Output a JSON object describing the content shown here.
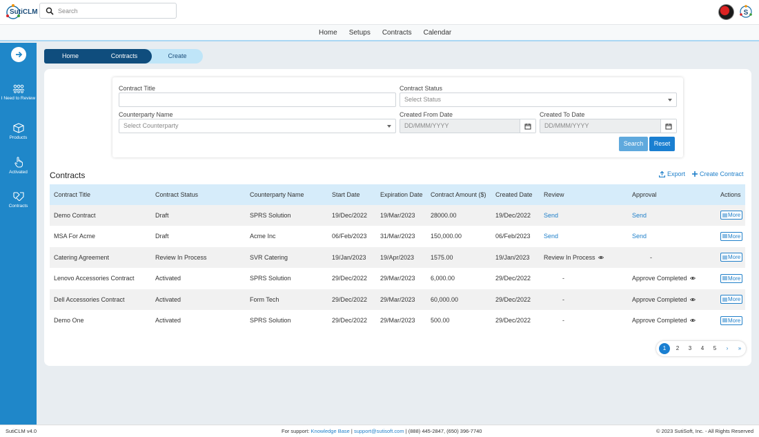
{
  "app": {
    "logo_text": "SutiCLM"
  },
  "search": {
    "placeholder": "Search"
  },
  "nav": {
    "items": [
      "Home",
      "Setups",
      "Contracts",
      "Calendar"
    ]
  },
  "sidebar": {
    "items": [
      {
        "label": "I Need to Review",
        "icon": "people-review-icon"
      },
      {
        "label": "Products",
        "icon": "box-icon"
      },
      {
        "label": "Activated",
        "icon": "hand-pointer-icon"
      },
      {
        "label": "Contracts",
        "icon": "handshake-icon"
      }
    ]
  },
  "breadcrumb": {
    "home": "Home",
    "contracts": "Contracts",
    "create": "Create"
  },
  "filters": {
    "contract_title_label": "Contract Title",
    "contract_title_value": "",
    "contract_status_label": "Contract Status",
    "contract_status_placeholder": "Select Status",
    "counterparty_label": "Counterparty Name",
    "counterparty_placeholder": "Select Counterparty",
    "created_from_label": "Created From Date",
    "created_from_placeholder": "DD/MMM/YYYY",
    "created_to_label": "Created To Date",
    "created_to_placeholder": "DD/MMM/YYYY",
    "search_button": "Search",
    "reset_button": "Reset"
  },
  "contracts": {
    "title": "Contracts",
    "export_label": "Export",
    "create_label": "Create Contract",
    "columns": [
      "Contract Title",
      "Contract Status",
      "Counterparty Name",
      "Start Date",
      "Expiration Date",
      "Contract Amount ($)",
      "Created Date",
      "Review",
      "Approval",
      "Actions"
    ],
    "rows": [
      {
        "title": "Demo Contract",
        "status": "Draft",
        "counterparty": "SPRS Solution",
        "start": "19/Dec/2022",
        "expiration": "19/Mar/2023",
        "amount": "28000.00",
        "created": "19/Dec/2022",
        "review": "Send",
        "review_type": "link",
        "approval": "Send",
        "approval_type": "link",
        "action": "More"
      },
      {
        "title": "MSA For Acme",
        "status": "Draft",
        "counterparty": "Acme Inc",
        "start": "06/Feb/2023",
        "expiration": "31/Mar/2023",
        "amount": "150,000.00",
        "created": "06/Feb/2023",
        "review": "Send",
        "review_type": "link",
        "approval": "Send",
        "approval_type": "link",
        "action": "More"
      },
      {
        "title": "Catering Agreement",
        "status": "Review In Process",
        "counterparty": "SVR Catering",
        "start": "19/Jan/2023",
        "expiration": "19/Apr/2023",
        "amount": "1575.00",
        "created": "19/Jan/2023",
        "review": "Review In Process",
        "review_type": "eye",
        "approval": "-",
        "approval_type": "dash",
        "action": "More"
      },
      {
        "title": "Lenovo Accessories Contract",
        "status": "Activated",
        "counterparty": "SPRS Solution",
        "start": "29/Dec/2022",
        "expiration": "29/Mar/2023",
        "amount": "6,000.00",
        "created": "29/Dec/2022",
        "review": "-",
        "review_type": "dash",
        "approval": "Approve Completed",
        "approval_type": "eye",
        "action": "More"
      },
      {
        "title": "Dell Accessories Contract",
        "status": "Activated",
        "counterparty": "Form Tech",
        "start": "29/Dec/2022",
        "expiration": "29/Mar/2023",
        "amount": "60,000.00",
        "created": "29/Dec/2022",
        "review": "-",
        "review_type": "dash",
        "approval": "Approve Completed",
        "approval_type": "eye",
        "action": "More"
      },
      {
        "title": "Demo One",
        "status": "Activated",
        "counterparty": "SPRS Solution",
        "start": "29/Dec/2022",
        "expiration": "29/Mar/2023",
        "amount": "500.00",
        "created": "29/Dec/2022",
        "review": "-",
        "review_type": "dash",
        "approval": "Approve Completed",
        "approval_type": "eye",
        "action": "More"
      }
    ]
  },
  "pagination": {
    "pages": [
      "1",
      "2",
      "3",
      "4",
      "5"
    ],
    "current": "1",
    "next": "›",
    "last": "»"
  },
  "footer": {
    "version": "SutiCLM v4.0",
    "support_prefix": "For support: ",
    "knowledge_base": "Knowledge Base",
    "separator1": " | ",
    "email": "support@sutisoft.com",
    "phones": " | (888) 445-2847, (650) 396-7740",
    "copyright": "© 2023 SutiSoft, Inc. - All Rights Reserved"
  },
  "colors": {
    "primary": "#1f87c9",
    "dark_blue": "#0f4d7d",
    "header_row": "#d6ecfa",
    "link": "#1f7fc9"
  }
}
